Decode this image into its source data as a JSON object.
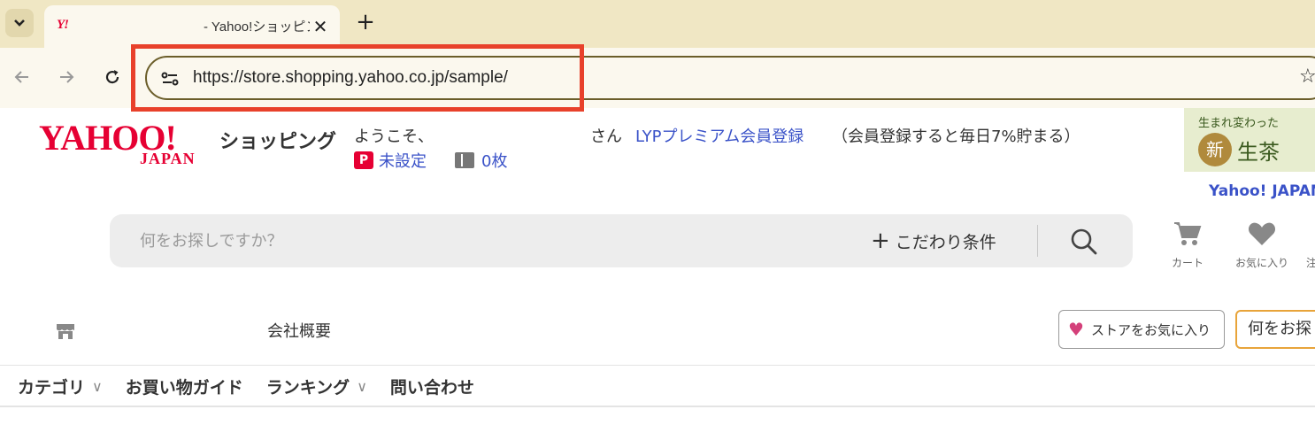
{
  "browser": {
    "tab": {
      "favicon_text": "Y!",
      "title": "- Yahoo!ショッピング",
      "close_glyph": "✕"
    },
    "new_tab_glyph": "+",
    "url": "https://store.shopping.yahoo.co.jp/sample/",
    "highlight_color": "#e8412b"
  },
  "header": {
    "logo_main": "YAHOO!",
    "logo_sub": "JAPAN",
    "logo_service": "ショッピング",
    "welcome": "ようこそ、",
    "welcome_suffix": "さん",
    "premium_link": "LYPプレミアム会員登録",
    "premium_note": "（会員登録すると毎日7%貯まる）",
    "paypay_icon": "P",
    "paypay_label": "未設定",
    "coupon_label": "0枚",
    "ad": {
      "line1": "生まれ変わった",
      "circle": "新",
      "tea": "生茶"
    },
    "yahoo_japan_link": "Yahoo! JAPAN"
  },
  "search": {
    "placeholder": "何をお探しですか？",
    "detail_label": "こだわり条件",
    "detail_plus": "+"
  },
  "utilities": {
    "cart_label": "カート",
    "favorites_label": "お気に入り",
    "cut_label": "注"
  },
  "store": {
    "company_link": "会社概要",
    "favorite_store_label": "ストアをお気に入り",
    "store_search_placeholder": "何をお探"
  },
  "store_nav": [
    {
      "label": "カテゴリ",
      "has_chevron": true
    },
    {
      "label": "お買い物ガイド",
      "has_chevron": false
    },
    {
      "label": "ランキング",
      "has_chevron": true
    },
    {
      "label": "問い合わせ",
      "has_chevron": false
    }
  ],
  "colors": {
    "yahoo_red": "#e60033",
    "link_blue": "#3a52c8",
    "chrome_bg": "#f0e7c4"
  }
}
